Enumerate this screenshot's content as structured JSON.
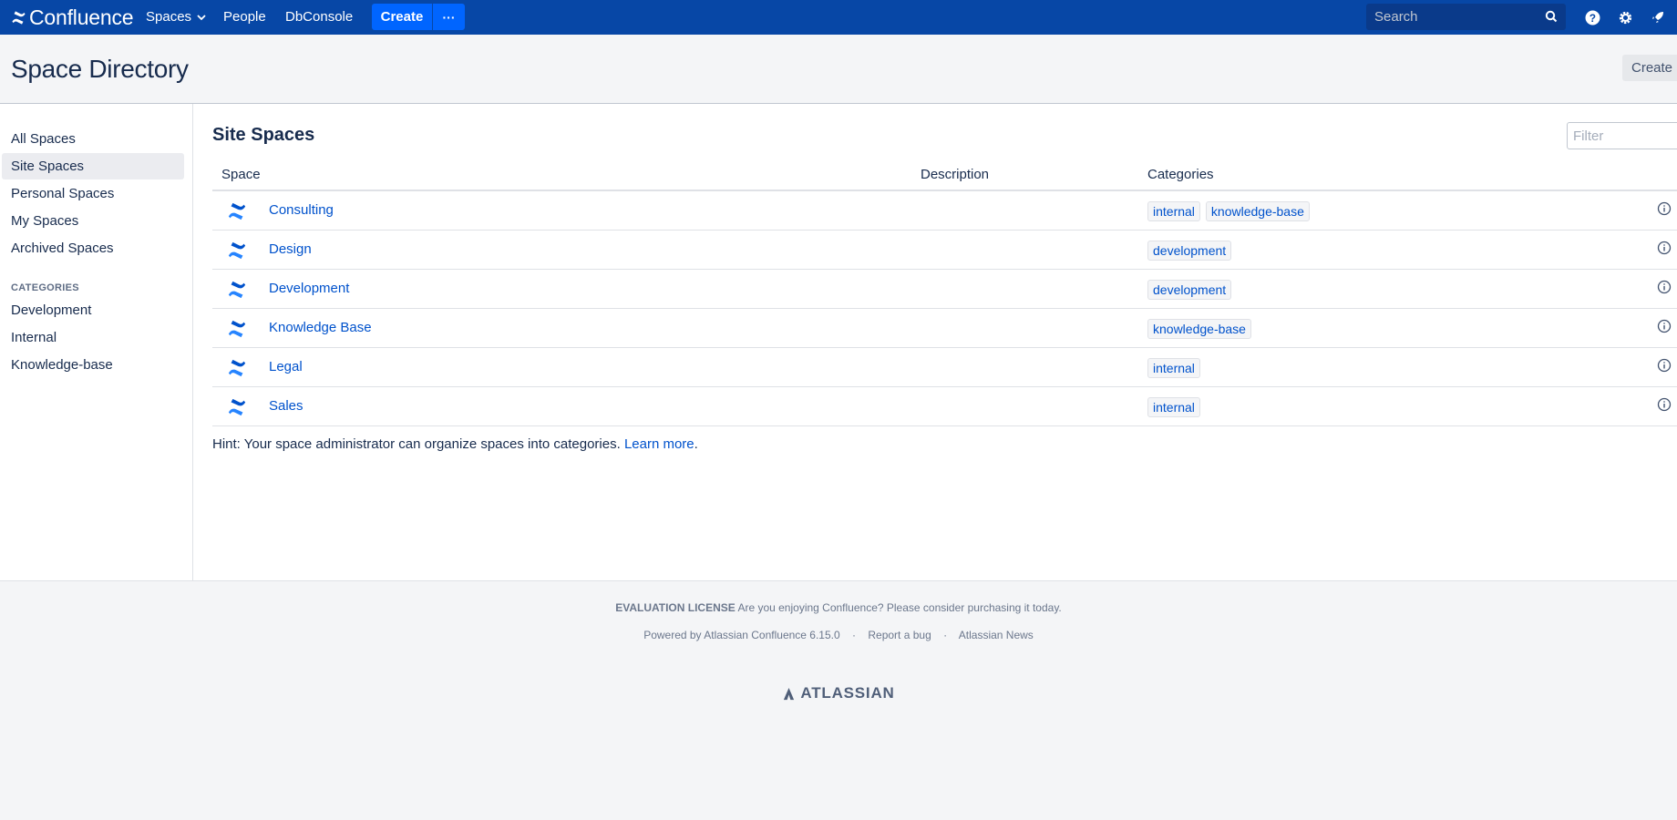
{
  "nav": {
    "product": "Confluence",
    "spaces_label": "Spaces",
    "people_label": "People",
    "dbconsole_label": "DbConsole",
    "create_label": "Create",
    "more_label": "···",
    "search_placeholder": "Search",
    "colors": {
      "bar": "#0747a6",
      "button": "#0065ff"
    }
  },
  "header": {
    "title": "Space Directory",
    "create_space_label": "Create Space"
  },
  "sidebar": {
    "items": [
      {
        "label": "All Spaces"
      },
      {
        "label": "Site Spaces",
        "active": true
      },
      {
        "label": "Personal Spaces"
      },
      {
        "label": "My Spaces"
      },
      {
        "label": "Archived Spaces"
      }
    ],
    "categories_heading": "CATEGORIES",
    "categories": [
      {
        "label": "Development"
      },
      {
        "label": "Internal"
      },
      {
        "label": "Knowledge-base"
      }
    ]
  },
  "main": {
    "section_title": "Site Spaces",
    "filter_placeholder": "Filter",
    "columns": [
      "Space",
      "Description",
      "Categories"
    ],
    "rows": [
      {
        "name": "Consulting",
        "description": "",
        "categories": [
          "internal",
          "knowledge-base"
        ]
      },
      {
        "name": "Design",
        "description": "",
        "categories": [
          "development"
        ]
      },
      {
        "name": "Development",
        "description": "",
        "categories": [
          "development"
        ]
      },
      {
        "name": "Knowledge Base",
        "description": "",
        "categories": [
          "knowledge-base"
        ]
      },
      {
        "name": "Legal",
        "description": "",
        "categories": [
          "internal"
        ]
      },
      {
        "name": "Sales",
        "description": "",
        "categories": [
          "internal"
        ]
      }
    ],
    "hint_text": "Hint: Your space administrator can organize spaces into categories.",
    "hint_link": "Learn more",
    "hint_end": "."
  },
  "footer": {
    "license_label": "EVALUATION LICENSE",
    "license_text": "Are you enjoying Confluence? Please consider purchasing it today.",
    "powered_by": "Powered by Atlassian Confluence 6.15.0",
    "report_bug": "Report a bug",
    "news": "Atlassian News",
    "separator": "·",
    "brand": "ATLASSIAN"
  }
}
